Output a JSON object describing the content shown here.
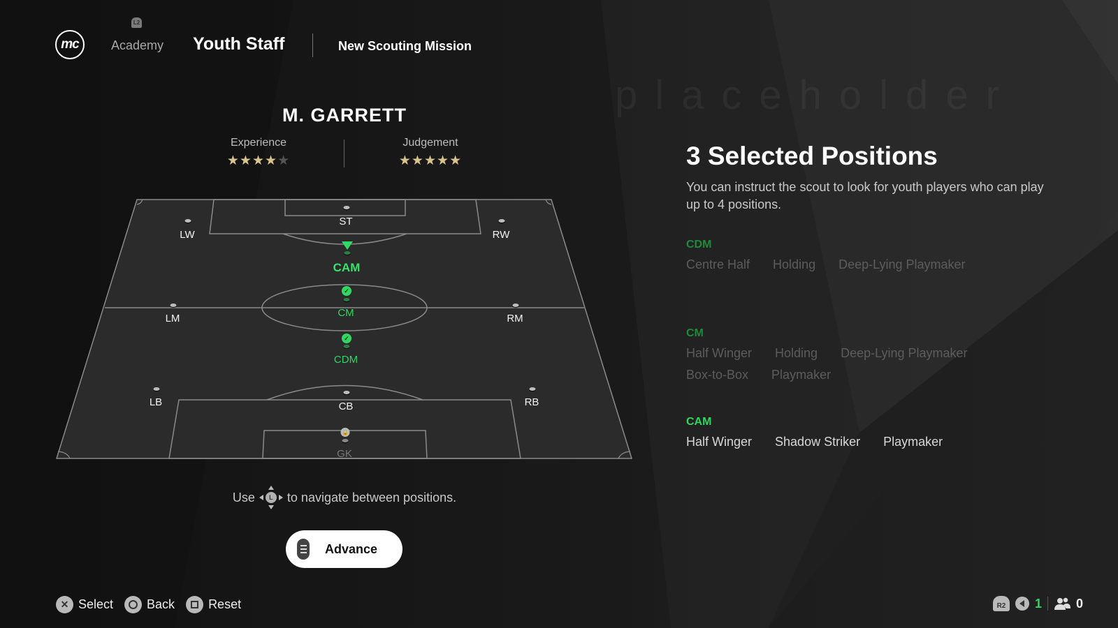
{
  "header": {
    "logo_text": "mc",
    "l2_hint": "L2",
    "tabs": [
      {
        "label": "Academy",
        "state": "inactive"
      },
      {
        "label": "Youth Staff",
        "state": "active"
      }
    ],
    "breadcrumb": "New Scouting Mission",
    "watermark": "placeholder"
  },
  "scout": {
    "name": "M. GARRETT",
    "attributes": [
      {
        "label": "Experience",
        "stars": 4,
        "max_stars": 5
      },
      {
        "label": "Judgement",
        "stars": 5,
        "max_stars": 5
      }
    ]
  },
  "pitch": {
    "positions": [
      {
        "code": "ST",
        "state": "default"
      },
      {
        "code": "LW",
        "state": "default"
      },
      {
        "code": "RW",
        "state": "default"
      },
      {
        "code": "CAM",
        "state": "current"
      },
      {
        "code": "CM",
        "state": "selected"
      },
      {
        "code": "LM",
        "state": "default"
      },
      {
        "code": "RM",
        "state": "default"
      },
      {
        "code": "CDM",
        "state": "selected"
      },
      {
        "code": "LB",
        "state": "default"
      },
      {
        "code": "CB",
        "state": "default"
      },
      {
        "code": "RB",
        "state": "default"
      },
      {
        "code": "GK",
        "state": "locked"
      }
    ]
  },
  "hint": {
    "before": "Use",
    "stick": "L",
    "after": "to navigate between positions."
  },
  "advance_button": {
    "label": "Advance"
  },
  "selection": {
    "title": "3 Selected Positions",
    "description": "You can instruct the scout to look for youth players who can play up to 4 positions.",
    "groups": [
      {
        "position": "CDM",
        "roles": [
          "Centre Half",
          "Holding",
          "Deep-Lying Playmaker"
        ],
        "state": "dim"
      },
      {
        "position": "CM",
        "roles": [
          "Half Winger",
          "Holding",
          "Deep-Lying Playmaker",
          "Box-to-Box",
          "Playmaker"
        ],
        "state": "dim"
      },
      {
        "position": "CAM",
        "roles": [
          "Half Winger",
          "Shadow Striker",
          "Playmaker"
        ],
        "state": "active"
      }
    ]
  },
  "footer": {
    "actions": [
      {
        "button": "cross",
        "label": "Select"
      },
      {
        "button": "circle",
        "label": "Back"
      },
      {
        "button": "square",
        "label": "Reset"
      }
    ],
    "status": {
      "r2_label": "R2",
      "voice_count": "1",
      "party_count": "0"
    }
  },
  "colors": {
    "accent_green": "#2fd65f",
    "dim_green": "#1f8a3c",
    "star_gold": "#d8c48c",
    "background": "#141414"
  }
}
